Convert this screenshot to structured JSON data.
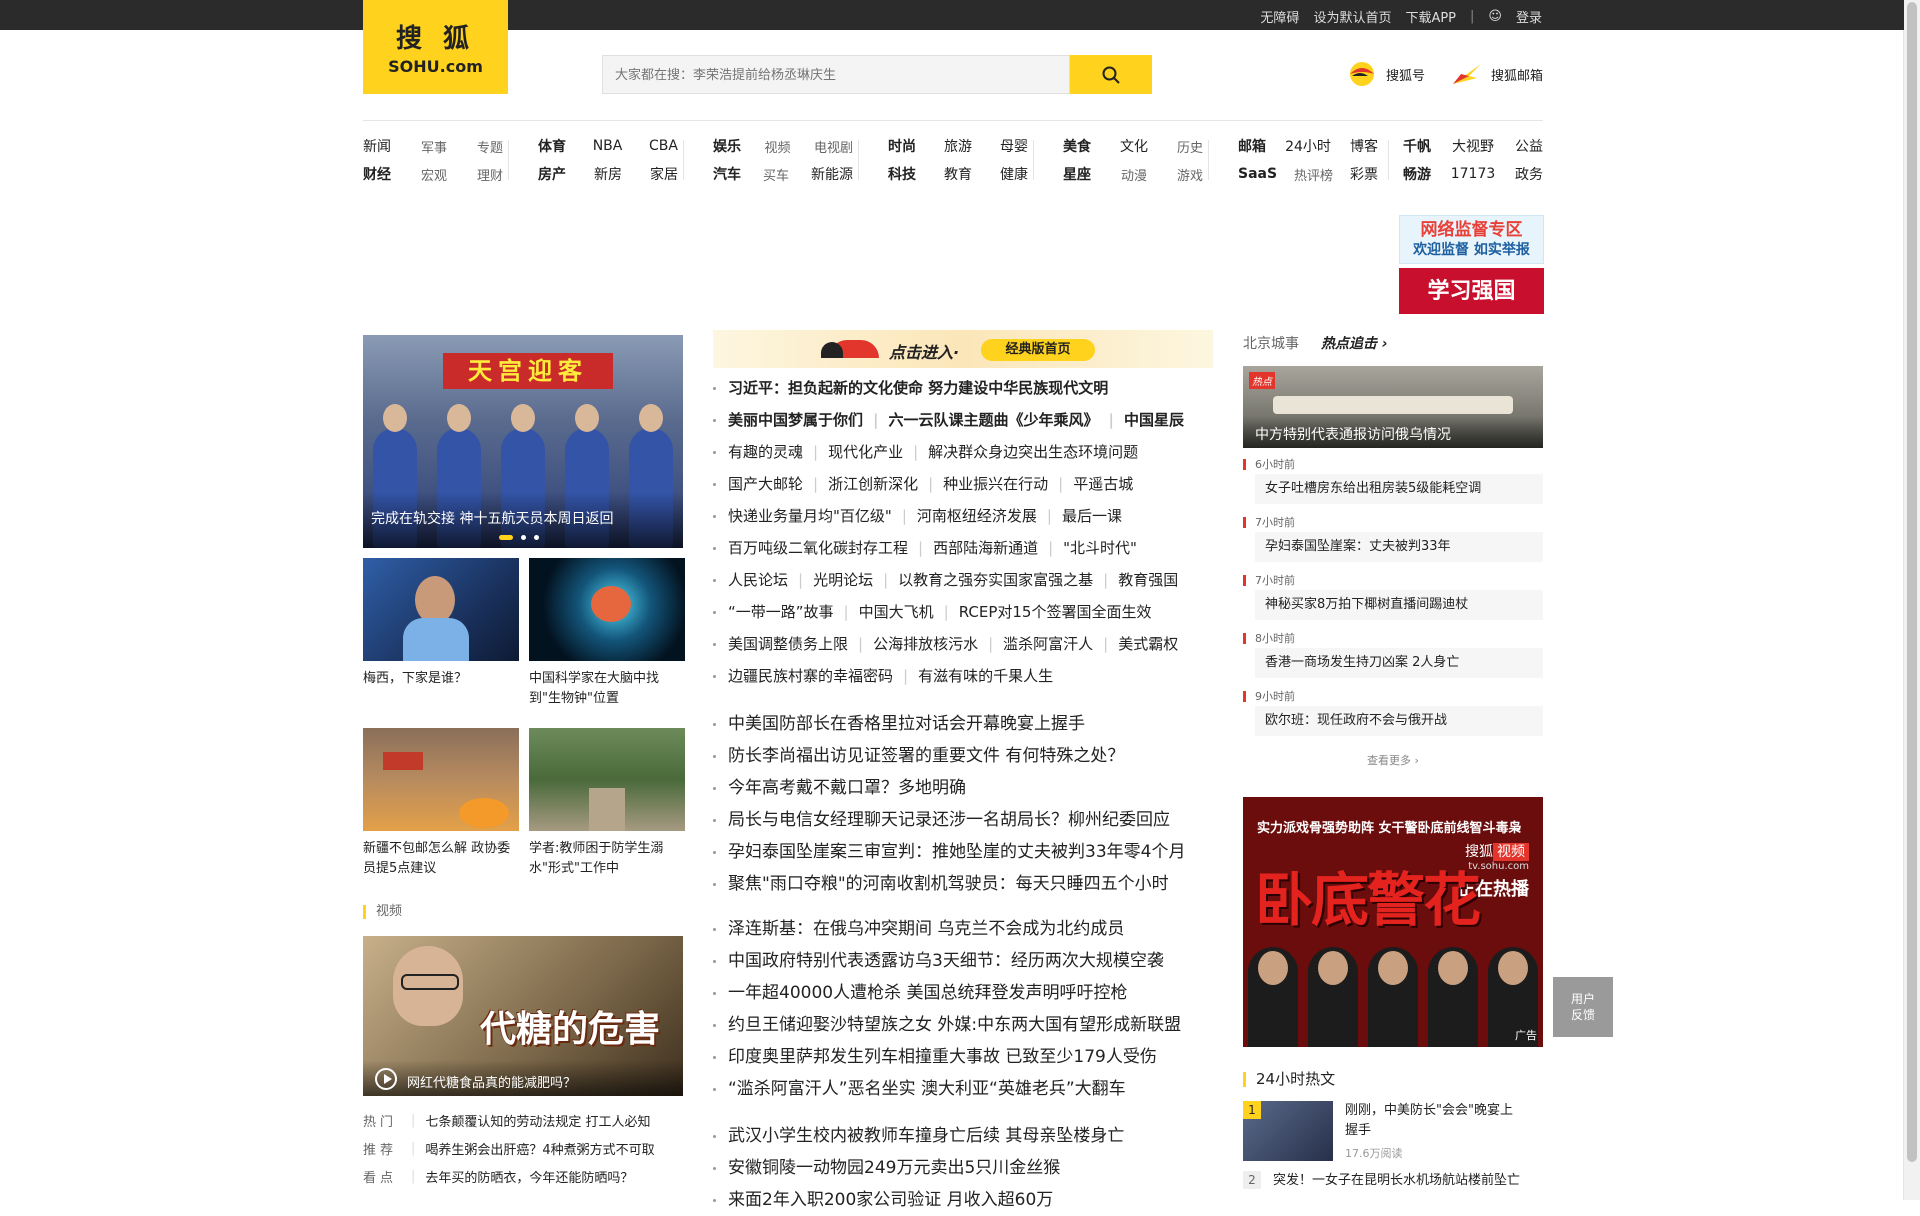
{
  "topbar": {
    "accessibility": "无障碍",
    "set_home": "设为默认首页",
    "download_app": "下载APP",
    "login": "登录"
  },
  "logo": {
    "cn": "搜 狐",
    "en": "SOHU.com"
  },
  "search": {
    "placeholder": "大家都在搜：李荣浩提前给杨丞琳庆生"
  },
  "header_links": [
    {
      "label": "搜狐号",
      "icon": "sohu-hao-icon"
    },
    {
      "label": "搜狐邮箱",
      "icon": "sohu-mail-icon"
    }
  ],
  "nav": [
    {
      "rows": [
        [
          "新闻",
          "军事",
          "专题"
        ],
        [
          "财经",
          "宏观",
          "理财"
        ]
      ]
    },
    {
      "rows": [
        [
          "体育",
          "NBA",
          "CBA"
        ],
        [
          "房产",
          "新房",
          "家居"
        ]
      ]
    },
    {
      "rows": [
        [
          "娱乐",
          "视频",
          "电视剧"
        ],
        [
          "汽车",
          "买车",
          "新能源"
        ]
      ]
    },
    {
      "rows": [
        [
          "时尚",
          "旅游",
          "母婴"
        ],
        [
          "科技",
          "教育",
          "健康"
        ]
      ]
    },
    {
      "rows": [
        [
          "美食",
          "文化",
          "历史"
        ],
        [
          "星座",
          "动漫",
          "游戏"
        ]
      ]
    },
    {
      "rows": [
        [
          "邮箱",
          "24小时",
          "博客"
        ],
        [
          "SaaS",
          "热评榜",
          "彩票"
        ]
      ]
    },
    {
      "rows": [
        [
          "千帆",
          "大视野",
          "公益"
        ],
        [
          "畅游",
          "17173",
          "政务"
        ]
      ]
    }
  ],
  "ads_right": {
    "net_supervision_title": "网络监督专区",
    "net_supervision_sub": "欢迎监督 如实举报",
    "xuexi": "学习强国"
  },
  "slider": {
    "caption": "完成在轨交接 神十五航天员本周日返回",
    "banner": "天宫迎客"
  },
  "thumbs": [
    {
      "title": "梅西，下家是谁？"
    },
    {
      "title": "中国科学家在大脑中找到\"生物钟\"位置"
    },
    {
      "title": "新疆不包邮怎么解 政协委员提5点建议"
    },
    {
      "title": "学者:教师困于防学生溺水\"形式\"工作中"
    }
  ],
  "video_section": {
    "label": "视频",
    "big_text": "代糖的危害",
    "caption": "网红代糖食品真的能减肥吗？"
  },
  "hot_list": [
    {
      "key": "热门",
      "text": "七条颠覆认知的劳动法规定 打工人必知"
    },
    {
      "key": "推荐",
      "text": "喝养生粥会出肝癌？4种煮粥方式不可取"
    },
    {
      "key": "看点",
      "text": "去年买的防晒衣，今年还能防晒吗？"
    }
  ],
  "mid_banner": {
    "click_text": "点击进入·",
    "classic": "经典版首页"
  },
  "news_group1": [
    [
      {
        "t": "习近平：担负起新的文化使命 努力建设中华民族现代文明",
        "b": true
      }
    ],
    [
      {
        "t": "美丽中国梦属于你们",
        "b": true
      },
      {
        "t": "六一云队课主题曲《少年乘风》",
        "b": true
      },
      {
        "t": "中国星辰",
        "b": true
      }
    ],
    [
      {
        "t": "有趣的灵魂"
      },
      {
        "t": "现代化产业"
      },
      {
        "t": "解决群众身边突出生态环境问题"
      }
    ],
    [
      {
        "t": "国产大邮轮"
      },
      {
        "t": "浙江创新深化"
      },
      {
        "t": "种业振兴在行动"
      },
      {
        "t": "平遥古城"
      }
    ],
    [
      {
        "t": "快递业务量月均\"百亿级\""
      },
      {
        "t": "河南枢纽经济发展"
      },
      {
        "t": "最后一课"
      }
    ],
    [
      {
        "t": "百万吨级二氧化碳封存工程"
      },
      {
        "t": "西部陆海新通道"
      },
      {
        "t": "\"北斗时代\""
      }
    ],
    [
      {
        "t": "人民论坛"
      },
      {
        "t": "光明论坛"
      },
      {
        "t": "以教育之强夯实国家富强之基"
      },
      {
        "t": "教育强国"
      }
    ],
    [
      {
        "t": "“一带一路”故事"
      },
      {
        "t": "中国大飞机"
      },
      {
        "t": "RCEP对15个签署国全面生效"
      }
    ],
    [
      {
        "t": "美国调整债务上限"
      },
      {
        "t": "公海排放核污水"
      },
      {
        "t": "滥杀阿富汗人"
      },
      {
        "t": "美式霸权"
      }
    ],
    [
      {
        "t": "边疆民族村寨的幸福密码"
      },
      {
        "t": "有滋有味的千果人生"
      }
    ]
  ],
  "news_group2": [
    "中美国防部长在香格里拉对话会开幕晚宴上握手",
    "防长李尚福出访见证签署的重要文件 有何特殊之处？",
    "今年高考戴不戴口罩？多地明确",
    "局长与电信女经理聊天记录还涉一名胡局长？柳州纪委回应",
    "孕妇泰国坠崖案三审宣判：推她坠崖的丈夫被判33年零4个月",
    "聚焦\"雨口夺粮\"的河南收割机驾驶员：每天只睡四五个小时"
  ],
  "news_group3": [
    "泽连斯基：在俄乌冲突期间 乌克兰不会成为北约成员",
    "中国政府特别代表透露访乌3天细节：经历两次大规模空袭",
    "一年超40000人遭枪杀 美国总统拜登发声明呼吁控枪",
    "约旦王储迎娶沙特望族之女 外媒:中东两大国有望形成新联盟",
    "印度奥里萨邦发生列车相撞重大事故 已致至少179人受伤",
    "“滥杀阿富汗人”恶名坐实 澳大利亚“英雄老兵”大翻车"
  ],
  "news_group4": [
    "武汉小学生校内被教师车撞身亡后续 其母亲坠楼身亡",
    "安徽铜陵一动物园249万元卖出5只川金丝猴",
    "来面2年入职200家公司验证 月收入超60万"
  ],
  "right_col": {
    "city": "北京城事",
    "hot_chase": "热点追击",
    "top_img_caption": "中方特别代表通报访问俄乌情况",
    "top_img_tag": "热点",
    "timeline": [
      {
        "time": "6小时前",
        "title": "女子吐槽房东给出租房装5级能耗空调"
      },
      {
        "time": "7小时前",
        "title": "孕妇泰国坠崖案：丈夫被判33年"
      },
      {
        "time": "7小时前",
        "title": "神秘买家8万拍下椰树直播间踢迪杖"
      },
      {
        "time": "8小时前",
        "title": "香港一商场发生持刀凶案 2人身亡"
      },
      {
        "time": "9小时前",
        "title": "欧尔班：现任政府不会与俄开战"
      }
    ],
    "more": "查看更多"
  },
  "right_ad": {
    "tagline": "实力派戏骨强势助阵 女干警卧底前线智斗毒枭",
    "title": "卧底警花",
    "brand": "搜狐",
    "brand2": "视频",
    "url": "tv.sohu.com",
    "now": "正在热播",
    "ad_label": "广告"
  },
  "hot24": {
    "title": "24小时热文",
    "items": [
      {
        "n": "1",
        "title": "刚刚，中美防长\"会会\"晚宴上握手",
        "reads": "17.6万阅读"
      },
      {
        "n": "2",
        "title": "突发！一女子在昆明长水机场航站楼前坠亡",
        "reads": ""
      }
    ]
  },
  "feedback": {
    "l1": "用户",
    "l2": "反馈"
  }
}
